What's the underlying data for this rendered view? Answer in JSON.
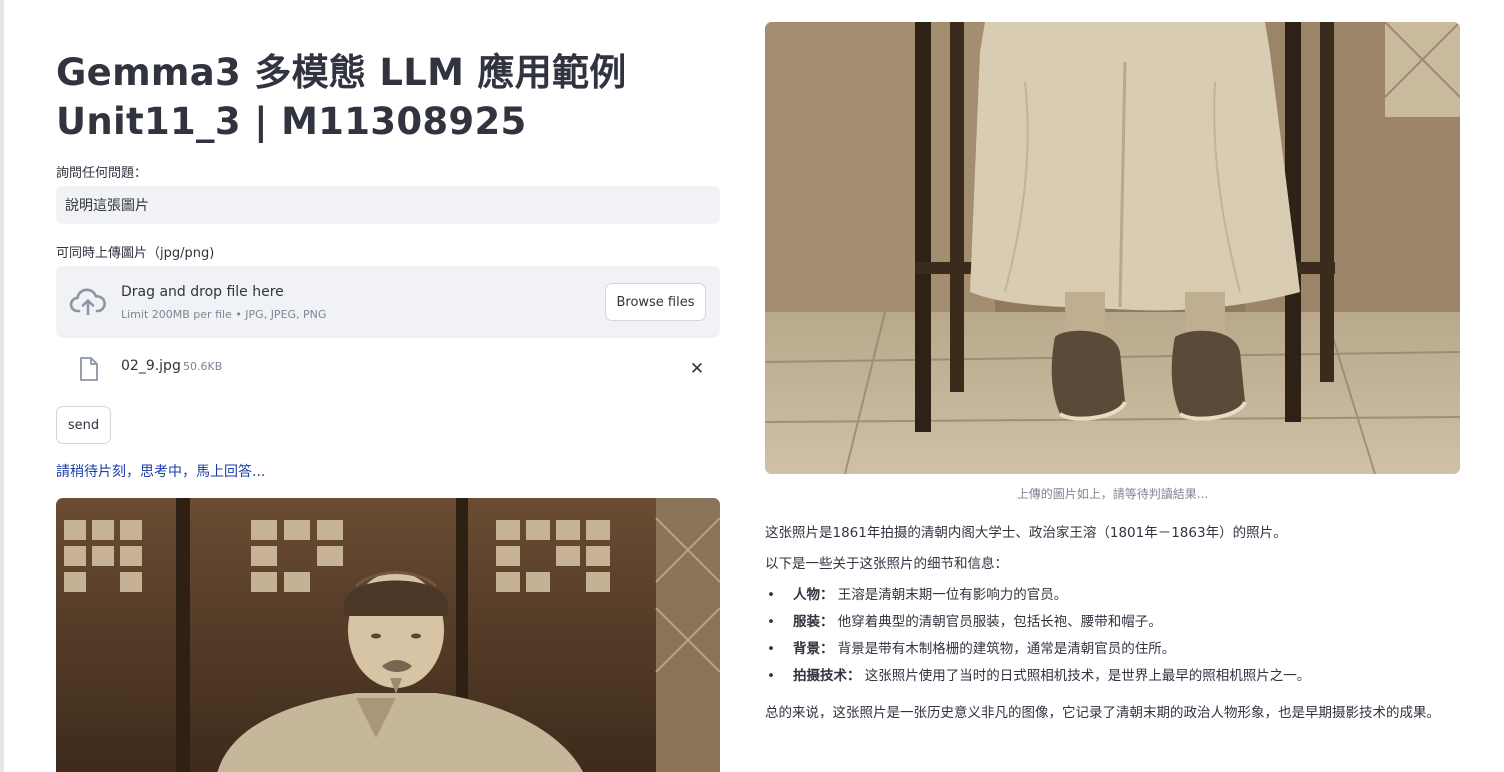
{
  "app": {
    "title_line1": "Gemma3 多模態 LLM 應用範例",
    "title_line2": "Unit11_3 | M11308925"
  },
  "question": {
    "label": "詢問任何問題：",
    "value": "說明這張圖片"
  },
  "uploader": {
    "label": "可同時上傳圖片（jpg/png)",
    "drop_title": "Drag and drop file here",
    "drop_sub": "Limit 200MB per file • JPG, JPEG, PNG",
    "browse_label": "Browse files",
    "icon": "cloud-upload-icon"
  },
  "file": {
    "name": "02_9.jpg",
    "size": "50.6KB",
    "close": "✕"
  },
  "send_label": "send",
  "wait_message": "請稍待片刻，思考中，馬上回答...",
  "image_caption": "上傳的圖片如上，請等待判讀結果...",
  "answer": {
    "intro": "这张照片是1861年拍摄的清朝内阁大学士、政治家王溶（1801年－1863年）的照片。",
    "lead": "以下是一些关于这张照片的细节和信息：",
    "bullets": [
      {
        "key": "人物：",
        "text": "王溶是清朝末期一位有影响力的官员。"
      },
      {
        "key": "服装：",
        "text": "他穿着典型的清朝官员服装，包括长袍、腰带和帽子。"
      },
      {
        "key": "背景：",
        "text": "背景是带有木制格栅的建筑物，通常是清朝官员的住所。"
      },
      {
        "key": "拍摄技术：",
        "text": "这张照片使用了当时的日式照相机技术，是世界上最早的照相机照片之一。"
      }
    ],
    "summary": "总的来说，这张照片是一张历史意义非凡的图像，它记录了清朝末期的政治人物形象，也是早期摄影技术的成果。"
  },
  "colors": {
    "accent_link": "#1a3ea8",
    "input_bg": "#f0f2f6",
    "sepia": "#b7a484"
  }
}
